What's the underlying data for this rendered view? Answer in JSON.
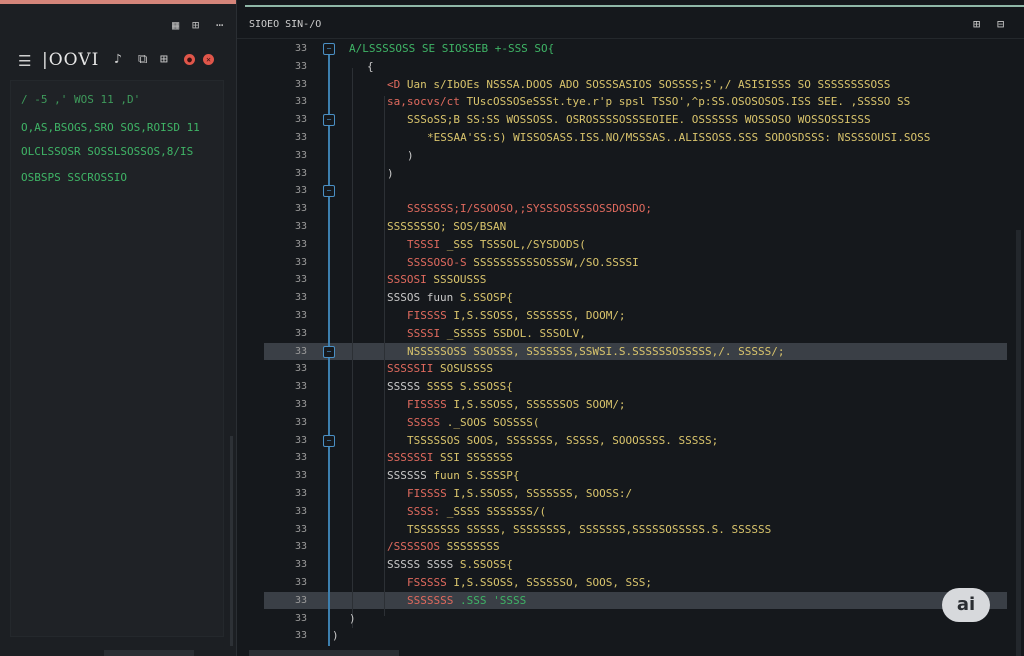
{
  "colors": {
    "accent_left": "#d5857a",
    "accent_editor": "#8fb7a7",
    "fold": "#4a8fc4",
    "string": "#d9c46c",
    "keyword": "#e06a5e",
    "green": "#3fb466"
  },
  "left_panel": {
    "title": "|OOVI",
    "icons": [
      "list-icon",
      "brush-icon",
      "copy-icon",
      "window-icon",
      "stop-icon",
      "close-icon"
    ],
    "lines": [
      "/ -5 ,' WOS  11 ,D'",
      "O,AS,BSOGS,SRO SOS,ROISD 11",
      "OLCLSSOSR SOSSLSOSSOS,8/IS",
      "OSBSPS SSCROSSIO"
    ]
  },
  "editor": {
    "tab_title": "SIOEO SIN-/O",
    "line_numbers": [
      "33",
      "33",
      "33",
      "33",
      "33",
      "33",
      "33",
      "33",
      "33",
      "33",
      "33",
      "33",
      "33",
      "33",
      "33",
      "33",
      "33",
      "33",
      "33",
      "33",
      "33",
      "33",
      "33",
      "33",
      "33",
      "33",
      "33",
      "33",
      "33",
      "33",
      "33",
      "33",
      "33",
      "33"
    ],
    "code": [
      "A/LSSSSOSS SE SIOSSEB +-SSS SO{",
      "{",
      "<D  Uan  s/IbOEs  NSSSA.DOOS  ADO  SOSSSASIOS  SOSSSS;S',/ ASISISSS  SO  SSSSSSSSOSS",
      "sa,socvs/ct  TUscOSSOSeSSSt.tye.r'p  spsl   TSSO',^p:SS.OSOSOSOS.ISS   SEE.  ,SSSSO  SS",
      "SSSoSS;B  SS:SS  WOSSOSS.  OSROSSSSOSSSEOIEE.  OSSSSSS  WOSSOSO  WOSSOSSISSS",
      "*ESSAA'SS:S)   WISSOSASS.ISS.NO/MSSSAS..ALISSOSS.SSS  SODOSDSSS:  NSSSSOUSI.SOSS",
      ")",
      ")",
      "",
      "SSSSSSS;I/SSOOSO,;SYSSSOSSSSOSSDOSDO;",
      "SSSSSSSO;  SOS/BSAN",
      "TSSSI  _SSS  TSSSOL,/SYSDODS(",
      "SSSSOSO-S  SSSSSSSSSSOSSSW,/SO.SSSSI",
      "SSSOSI  SSSOUSSS",
      "SSSOS fuun  S.SSOSP{",
      "FISSSS  I,S.SSOSS,  SSSSSSS,  DOOM/;",
      "SSSSI  _SSSSS  SSDOL.  SSSOLV,",
      "NSSSSSOSS  SSOSSS,  SSSSSSS,SSWSI.S.SSSSSSOSSSSS,/.  SSSSS/;",
      "SSSSSII  SOSUSSSS",
      "SSSSS  SSSS  S.SSOSS{",
      "FISSSS  I,S.SSOSS,  SSSSSSOS  SOOM/;",
      "SSSSS  ._SOOS  SOSSSS(",
      "TSSSSSOS  SOOS,  SSSSSSS,  SSSSS,  SOOOSSSS.  SSSSS;",
      "SSSSSSI  SSI  SSSSSSS",
      "SSSSSS  fuun  S.SSSSP{",
      "FISSSS  I,S.SSOSS,  SSSSSSS,  SOOSS:/",
      "SSSS:  _SSSS  SSSSSSS/(",
      "TSSSSSSS  SSSSS,  SSSSSSSS,  SSSSSSS,SSSSSOSSSSS.S.  SSSSSS",
      "/SSSSSOS  SSSSSSSS",
      "SSSSS SSSS  S.SSOSS{",
      "FSSSSS  I,S.SSOSS,  SSSSSSO,  SOOS,  SSS;",
      "SSSSSSS  .SSS  'SSSS",
      ")",
      ")"
    ]
  },
  "badge": "ai"
}
